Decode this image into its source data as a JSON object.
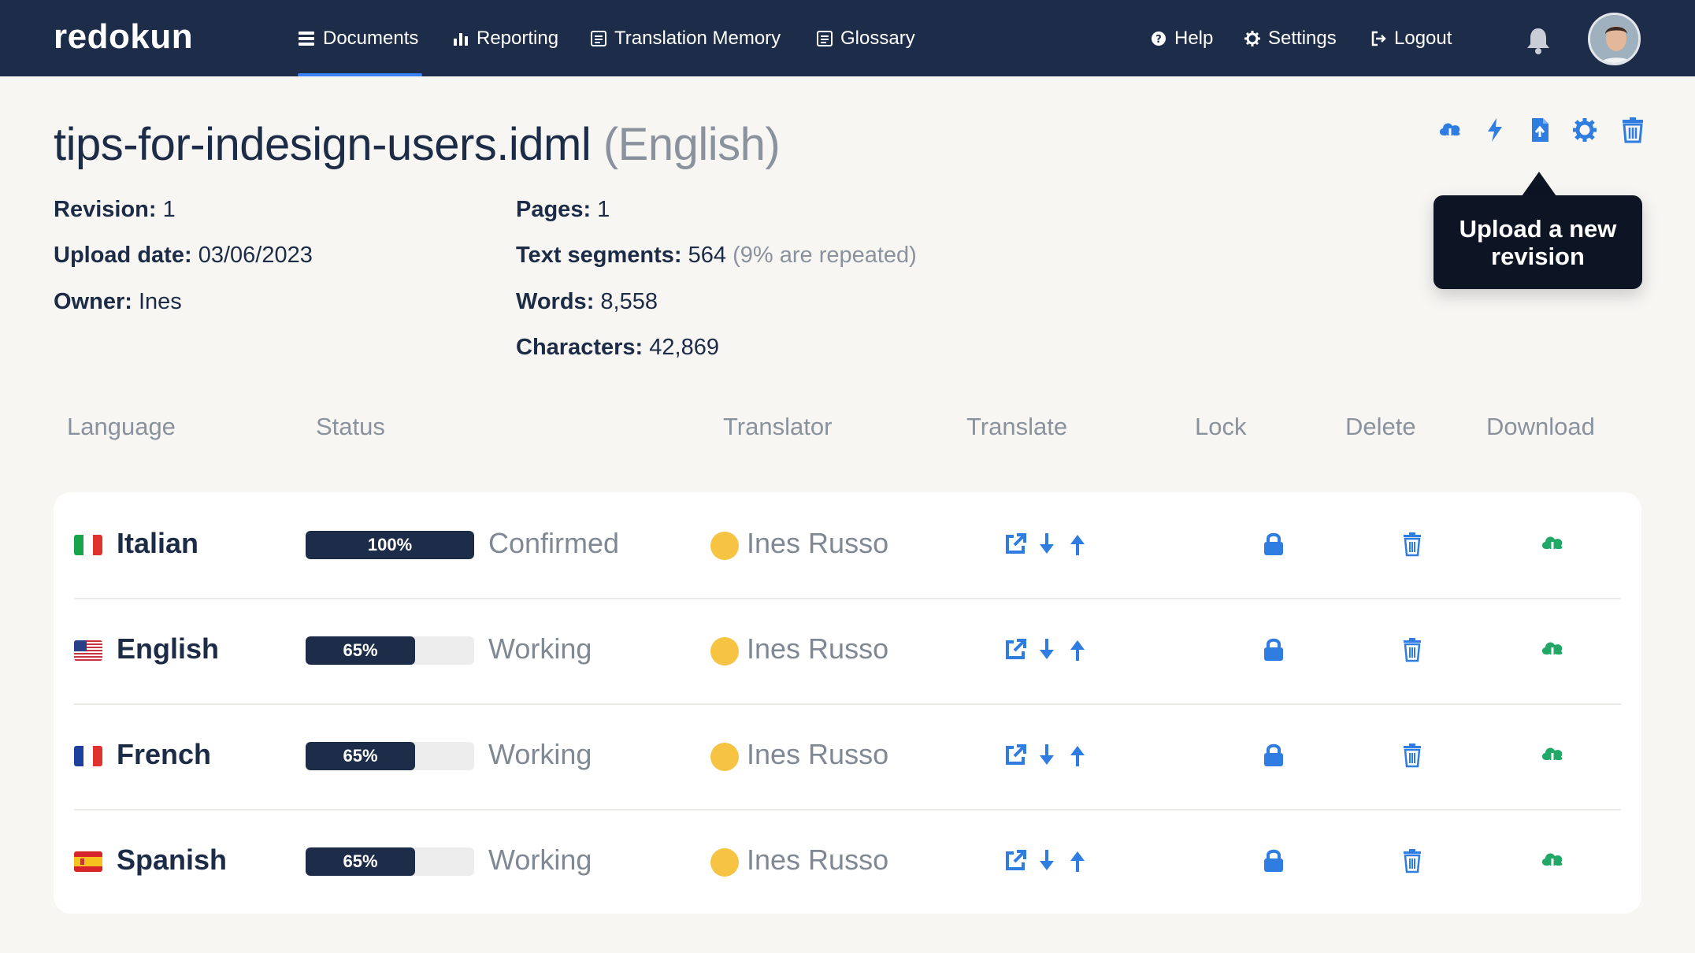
{
  "app": {
    "brand": "redokun"
  },
  "nav": {
    "items": [
      {
        "label": "Documents",
        "icon": "documents-icon"
      },
      {
        "label": "Reporting",
        "icon": "bar-chart-icon"
      },
      {
        "label": "Translation Memory",
        "icon": "memory-icon"
      },
      {
        "label": "Glossary",
        "icon": "glossary-icon"
      }
    ],
    "active": "Documents",
    "right": [
      {
        "label": "Help",
        "icon": "help-icon"
      },
      {
        "label": "Settings",
        "icon": "gear-icon"
      },
      {
        "label": "Logout",
        "icon": "logout-icon"
      }
    ]
  },
  "document": {
    "filename": "tips-for-indesign-users.idml",
    "language": "(English)",
    "revision_label": "Revision:",
    "revision": "1",
    "upload_date_label": "Upload date:",
    "upload_date": "03/06/2023",
    "owner_label": "Owner:",
    "owner": "Ines",
    "pages_label": "Pages:",
    "pages": "1",
    "segments_label": "Text segments:",
    "segments": "564",
    "segments_note": "(9% are repeated)",
    "words_label": "Words:",
    "words": "8,558",
    "characters_label": "Characters:",
    "characters": "42,869"
  },
  "toolbar": {
    "icons": [
      "cloud-download-icon",
      "lightning-icon",
      "upload-file-icon",
      "gear-icon",
      "trash-icon"
    ],
    "tooltip_line1": "Upload a new",
    "tooltip_line2": "revision"
  },
  "table": {
    "columns": [
      "Language",
      "Status",
      "Translator",
      "Translate",
      "Lock",
      "Delete",
      "Download"
    ],
    "rows": [
      {
        "language": "Italian",
        "flag": "italy",
        "progress": 100,
        "progress_label": "100%",
        "status": "Confirmed",
        "translator": "Ines Russo"
      },
      {
        "language": "English",
        "flag": "usa",
        "progress": 65,
        "progress_label": "65%",
        "status": "Working",
        "translator": "Ines Russo"
      },
      {
        "language": "French",
        "flag": "france",
        "progress": 65,
        "progress_label": "65%",
        "status": "Working",
        "translator": "Ines Russo"
      },
      {
        "language": "Spanish",
        "flag": "spain",
        "progress": 65,
        "progress_label": "65%",
        "status": "Working",
        "translator": "Ines Russo"
      }
    ]
  },
  "colors": {
    "nav_bg": "#1d2c48",
    "accent_blue": "#2f7de1",
    "download_green": "#22a866",
    "translator_dot": "#f6c343"
  }
}
